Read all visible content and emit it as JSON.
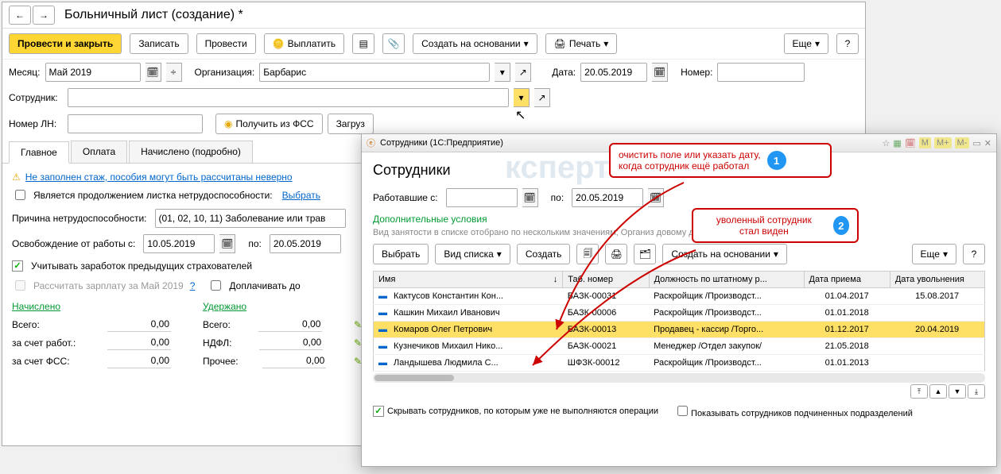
{
  "main": {
    "title": "Больничный лист (создание) *",
    "toolbar": {
      "submit": "Провести и закрыть",
      "save": "Записать",
      "post": "Провести",
      "pay": "Выплатить",
      "create_based": "Создать на основании",
      "print": "Печать",
      "more": "Еще",
      "help": "?"
    },
    "fields": {
      "month_lbl": "Месяц:",
      "month_val": "Май 2019",
      "org_lbl": "Организация:",
      "org_val": "Барбарис",
      "date_lbl": "Дата:",
      "date_val": "20.05.2019",
      "num_lbl": "Номер:",
      "emp_lbl": "Сотрудник:",
      "ln_lbl": "Номер ЛН:",
      "fss_btn": "Получить из ФСС",
      "load_btn": "Загруз"
    },
    "tabs": {
      "main": "Главное",
      "pay": "Оплата",
      "calc": "Начислено (подробно)"
    },
    "warn": "Не заполнен стаж, пособия могут быть рассчитаны неверно",
    "cont_lbl": "Является продолжением листка нетрудоспособности:",
    "cont_link": "Выбрать",
    "reason_lbl": "Причина нетрудоспособности:",
    "reason_val": "(01, 02, 10, 11) Заболевание или трав",
    "period_lbl": "Освобождение от работы с:",
    "period_from": "10.05.2019",
    "period_to_lbl": "по:",
    "period_to": "20.05.2019",
    "prev_ins": "Учитывать заработок предыдущих страхователей",
    "recalc": "Рассчитать зарплату за Май 2019",
    "extra_lbl": "Доплачивать до",
    "totals": {
      "acc_head": "Начислено",
      "ded_head": "Удержано",
      "total_lbl": "Всего:",
      "total_acc": "0,00",
      "total_ded": "0,00",
      "emp_lbl": "за счет работ.:",
      "emp_val": "0,00",
      "ndfl_lbl": "НДФЛ:",
      "ndfl_val": "0,00",
      "fss_lbl": "за счет ФСС:",
      "fss_val": "0,00",
      "other_lbl": "Прочее:",
      "other_val": "0,00"
    }
  },
  "sub": {
    "wintitle": "Сотрудники  (1С:Предприятие)",
    "title": "Сотрудники",
    "worked_lbl": "Работавшие с:",
    "worked_from": "",
    "worked_to_lbl": "по:",
    "worked_to": "20.05.2019",
    "addcond": "Дополнительные условия",
    "filter_info": "Вид занятости в списке отобрано по нескольким значениям; Организ                                                                                   довому договору: Да; Ф...",
    "tb": {
      "choose": "Выбрать",
      "viewmode": "Вид списка",
      "create": "Создать",
      "create_based": "Создать на основании",
      "more": "Еще",
      "help": "?"
    },
    "cols": {
      "name": "Имя",
      "tab": "Таб. номер",
      "pos": "Должность по штатному р...",
      "hired": "Дата приема",
      "fired": "Дата увольнения"
    },
    "rows": [
      {
        "name": "Кактусов Константин Кон...",
        "tab": "БАЗК-00031",
        "pos": "Раскройщик /Производст...",
        "hired": "01.04.2017",
        "fired": "15.08.2017"
      },
      {
        "name": "Кашкин Михаил Иванович",
        "tab": "БАЗК-00006",
        "pos": "Раскройщик /Производст...",
        "hired": "01.01.2018",
        "fired": ""
      },
      {
        "name": "Комаров Олег Петрович",
        "tab": "БАЗК-00013",
        "pos": "Продавец - кассир /Торго...",
        "hired": "01.12.2017",
        "fired": "20.04.2019"
      },
      {
        "name": "Кузнечиков Михаил Нико...",
        "tab": "БАЗК-00021",
        "pos": "Менеджер /Отдел закупок/",
        "hired": "21.05.2018",
        "fired": ""
      },
      {
        "name": "Ландышева Людмила С...",
        "tab": "ШФЗК-00012",
        "pos": "Раскройщик /Производст...",
        "hired": "01.01.2013",
        "fired": ""
      }
    ],
    "hide_chk": "Скрывать сотрудников, по которым уже не выполняются операции",
    "show_sub_chk": "Показывать сотрудников подчиненных подразделений"
  },
  "callouts": {
    "c1": "очистить поле или указать дату,\nкогда сотрудник ещё работал",
    "c2": "уволенный сотрудник\nстал виден"
  }
}
